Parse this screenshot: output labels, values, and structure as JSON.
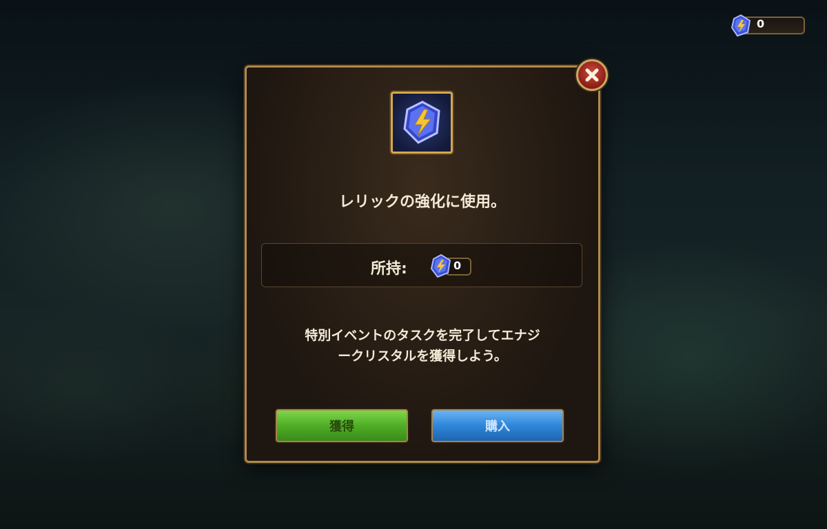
{
  "currency": {
    "icon": "energy-crystal-icon",
    "amount": "0"
  },
  "dialog": {
    "title": "レリックの強化に使用。",
    "owned_label": "所持:",
    "owned_amount": "0",
    "description_line1": "特別イベントのタスクを完了してエナジ",
    "description_line2": "ークリスタルを獲得しよう。",
    "get_button": "獲得",
    "buy_button": "購入"
  },
  "colors": {
    "panel_border": "#b08a4c",
    "text": "#f4ebd7",
    "green_button": "#4fae26",
    "blue_button": "#2f86d8",
    "close": "#8b1e16"
  }
}
